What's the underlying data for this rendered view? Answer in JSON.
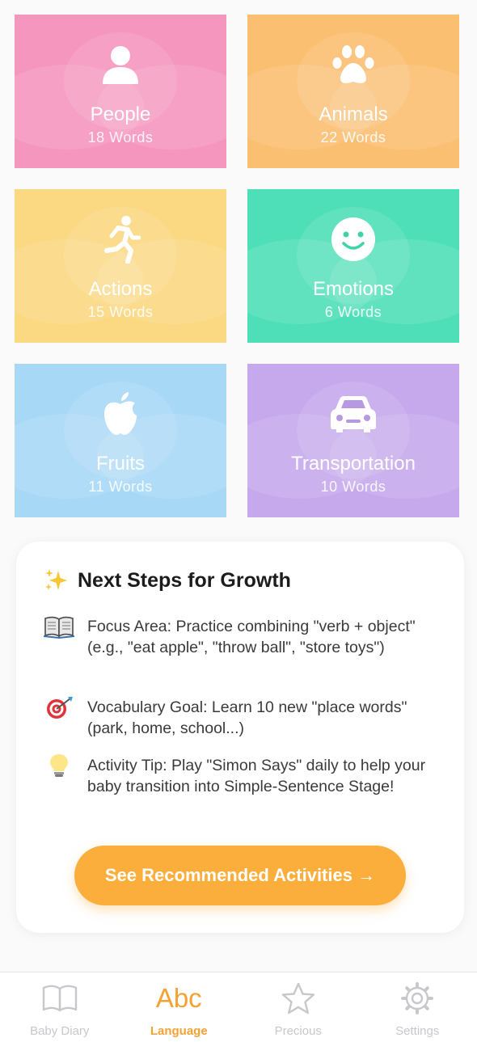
{
  "colors": {
    "people": "#f596bf",
    "animals": "#fbbf72",
    "actions": "#fbd882",
    "emotions": "#4fdfb8",
    "fruits": "#a7d8f6",
    "transportation": "#c6a9ec",
    "accent": "#f4a232",
    "button": "#fbae3c"
  },
  "categories": [
    {
      "name": "People",
      "count": "18 Words",
      "icon": "person-icon"
    },
    {
      "name": "Animals",
      "count": "22 Words",
      "icon": "paw-icon"
    },
    {
      "name": "Actions",
      "count": "15 Words",
      "icon": "running-icon"
    },
    {
      "name": "Emotions",
      "count": "6 Words",
      "icon": "smiley-icon"
    },
    {
      "name": "Fruits",
      "count": "11 Words",
      "icon": "apple-icon"
    },
    {
      "name": "Transportation",
      "count": "10 Words",
      "icon": "car-icon"
    }
  ],
  "next_steps": {
    "title": "Next Steps for Growth",
    "icon": "sparkles-icon",
    "tips": [
      {
        "icon": "book-icon",
        "text": "Focus Area: Practice combining \"verb + object\" (e.g., \"eat apple\", \"throw ball\", \"store toys\")"
      },
      {
        "icon": "target-icon",
        "text": "Vocabulary Goal: Learn 10 new \"place words\" (park, home, school...)"
      },
      {
        "icon": "lightbulb-icon",
        "text": "Activity Tip: Play \"Simon Says\" daily to help your baby transition into Simple-Sentence Stage!"
      }
    ],
    "button_label": "See Recommended Activities →"
  },
  "tabbar": {
    "tabs": [
      {
        "label": "Baby Diary",
        "icon": "book-icon",
        "active": false
      },
      {
        "label": "Language",
        "icon": "abc-icon",
        "icon_text": "Abc",
        "active": true
      },
      {
        "label": "Precious",
        "icon": "star-icon",
        "active": false
      },
      {
        "label": "Settings",
        "icon": "gear-icon",
        "active": false
      }
    ]
  }
}
